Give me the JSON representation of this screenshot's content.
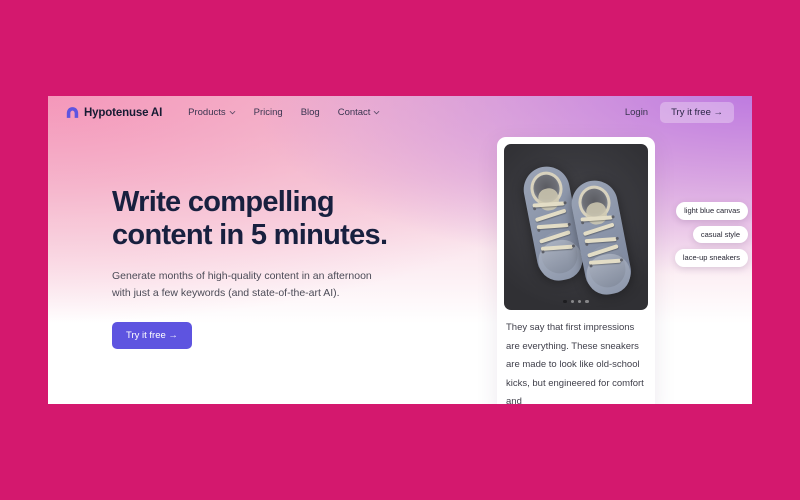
{
  "frame": {
    "background_color": "#d4186e"
  },
  "site": {
    "brand": {
      "name": "Hypotenuse AI",
      "icon": "hypotenuse-logo-icon",
      "accent_color": "#5e54e0"
    },
    "nav": {
      "links": [
        {
          "label": "Products",
          "has_dropdown": true
        },
        {
          "label": "Pricing",
          "has_dropdown": false
        },
        {
          "label": "Blog",
          "has_dropdown": false
        },
        {
          "label": "Contact",
          "has_dropdown": true
        }
      ],
      "login_label": "Login",
      "cta_label": "Try it free →"
    },
    "hero": {
      "headline": "Write compelling content in 5 minutes.",
      "subhead": "Generate months of high-quality content in an afternoon with just a few keywords (and state-of-the-art AI).",
      "cta_label": "Try it free →",
      "cta_color": "#5e54e0",
      "headline_color": "#18203f"
    },
    "product_card": {
      "image_alt": "grey lace-up canvas sneakers on dark background",
      "carousel": {
        "total_dots": 4,
        "active_index": 0
      },
      "description": "They say that first impressions are everything. These sneakers are made to look like old-school kicks, but engineered for comfort and",
      "tags": [
        "light blue canvas",
        "casual style",
        "lace-up sneakers"
      ]
    }
  }
}
